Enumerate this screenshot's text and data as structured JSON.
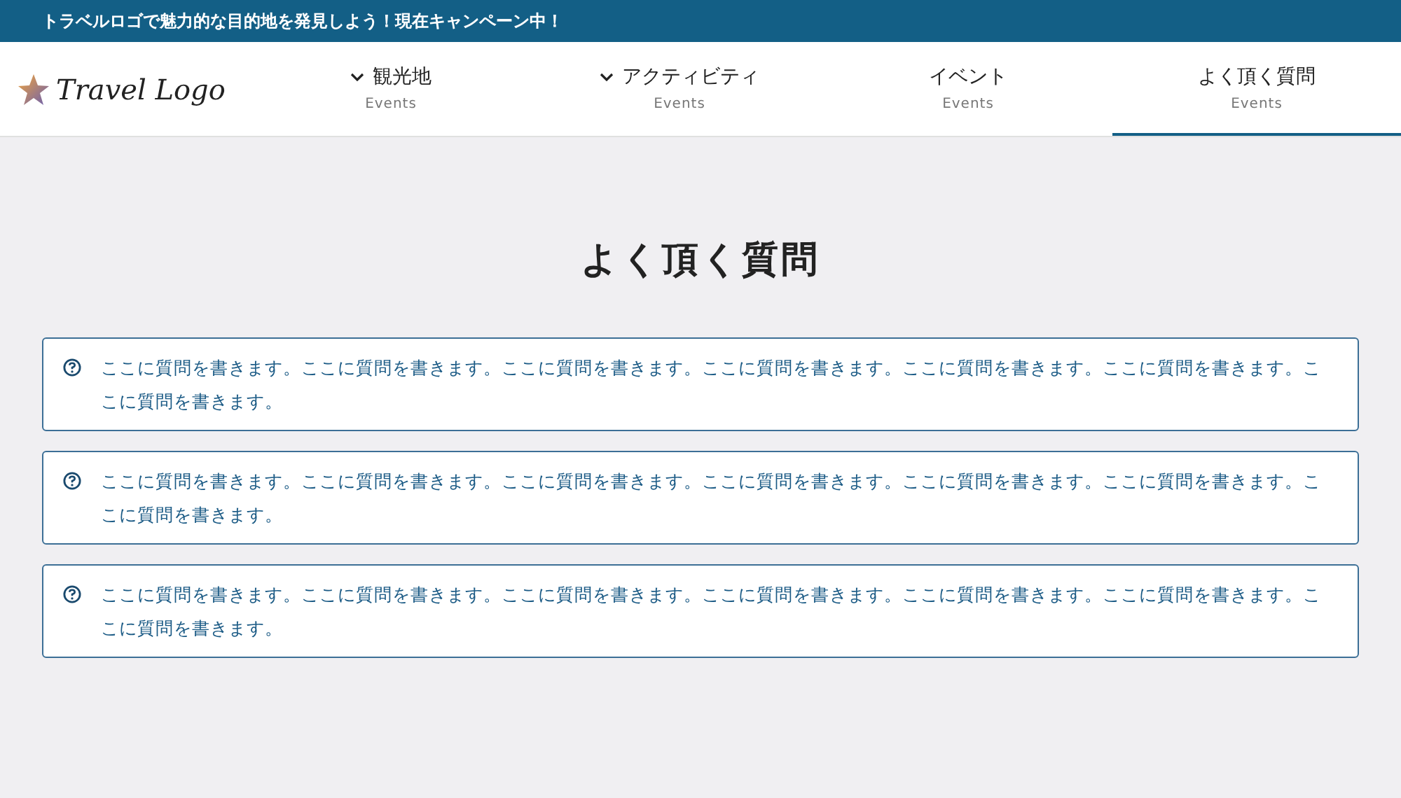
{
  "announcement": "トラベルロゴで魅力的な目的地を発見しよう！現在キャンペーン中！",
  "logo": {
    "text": "Travel Logo"
  },
  "nav": [
    {
      "label": "観光地",
      "sub": "Events",
      "has_menu": true,
      "selected": false
    },
    {
      "label": "アクティビティ",
      "sub": "Events",
      "has_menu": true,
      "selected": false
    },
    {
      "label": "イベント",
      "sub": "Events",
      "has_menu": false,
      "selected": false
    },
    {
      "label": "よく頂く質問",
      "sub": "Events",
      "has_menu": false,
      "selected": true
    }
  ],
  "page_title": "よく頂く質問",
  "faq": [
    {
      "question": "ここに質問を書きます。ここに質問を書きます。ここに質問を書きます。ここに質問を書きます。ここに質問を書きます。ここに質問を書きます。ここに質問を書きます。"
    },
    {
      "question": "ここに質問を書きます。ここに質問を書きます。ここに質問を書きます。ここに質問を書きます。ここに質問を書きます。ここに質問を書きます。ここに質問を書きます。"
    },
    {
      "question": "ここに質問を書きます。ここに質問を書きます。ここに質問を書きます。ここに質問を書きます。ここに質問を書きます。ここに質問を書きます。ここに質問を書きます。"
    }
  ]
}
